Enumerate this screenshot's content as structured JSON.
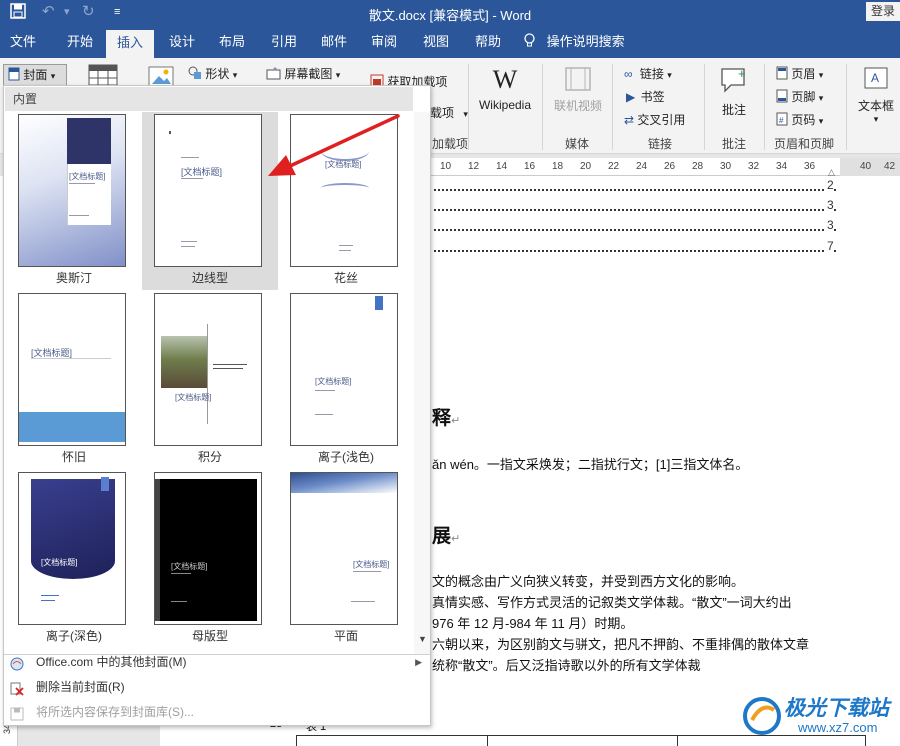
{
  "titlebar": {
    "title": "散文.docx [兼容模式]  -  Word",
    "login": "登录"
  },
  "tabs": [
    "文件",
    "开始",
    "插入",
    "设计",
    "布局",
    "引用",
    "邮件",
    "审阅",
    "视图",
    "帮助",
    "操作说明搜索"
  ],
  "ribbon": {
    "cover_btn": "封面",
    "shape_btn": "形状",
    "screenshot_btn": "屏幕截图",
    "addin_get": "获取加载项",
    "addin_mine": "载项",
    "addin_group": "加载项",
    "wikipedia": "Wikipedia",
    "online_video": "联机视频",
    "media_group": "媒体",
    "link": "链接",
    "bookmark": "书签",
    "crossref": "交叉引用",
    "links_group": "链接",
    "comment": "批注",
    "comment_group": "批注",
    "header": "页眉",
    "footer": "页脚",
    "pagenum": "页码",
    "hf_group": "页眉和页脚",
    "textbox": "文本框"
  },
  "ruler": [
    "10",
    "12",
    "14",
    "16",
    "18",
    "20",
    "22",
    "24",
    "26",
    "28",
    "30",
    "32",
    "34",
    "36",
    "40",
    "42"
  ],
  "document": {
    "toc_numbers": [
      "2",
      "3",
      "3",
      "7"
    ],
    "heading1": "释",
    "line1": "ǎn wén。一指文采焕发；二指扰行文；[1]三指文体名。",
    "heading2": "展",
    "line2": "文的概念由广义向狭义转变，并受到西方文化的影响。",
    "line3": "真情实感、写作方式灵活的记叙类文学体裁。“散文”一词大约出",
    "line4": "976 年 12 月-984 年 11 月）时期。",
    "line5": "六朝以来，为区别韵文与骈文，把凡不押韵、不重排偶的散体文章",
    "line6": "统称“散文”。后又泛指诗歌以外的所有文学体裁",
    "footer_num": "23",
    "footer_text": "表 1"
  },
  "panel": {
    "header": "内置",
    "templates": [
      "奥斯汀",
      "边线型",
      "花丝",
      "怀旧",
      "积分",
      "离子(浅色)",
      "离子(深色)",
      "母版型",
      "平面"
    ],
    "placeholder_title": "[文档标题]",
    "menu": [
      {
        "label": "Office.com 中的其他封面(M)"
      },
      {
        "label": "删除当前封面(R)"
      },
      {
        "label": "将所选内容保存到封面库(S)..."
      }
    ]
  },
  "watermark": {
    "brand": "极光下载站",
    "url": "www.xz7.com"
  },
  "colors": {
    "word_blue": "#2b579a",
    "arrow_red": "#e02020"
  }
}
